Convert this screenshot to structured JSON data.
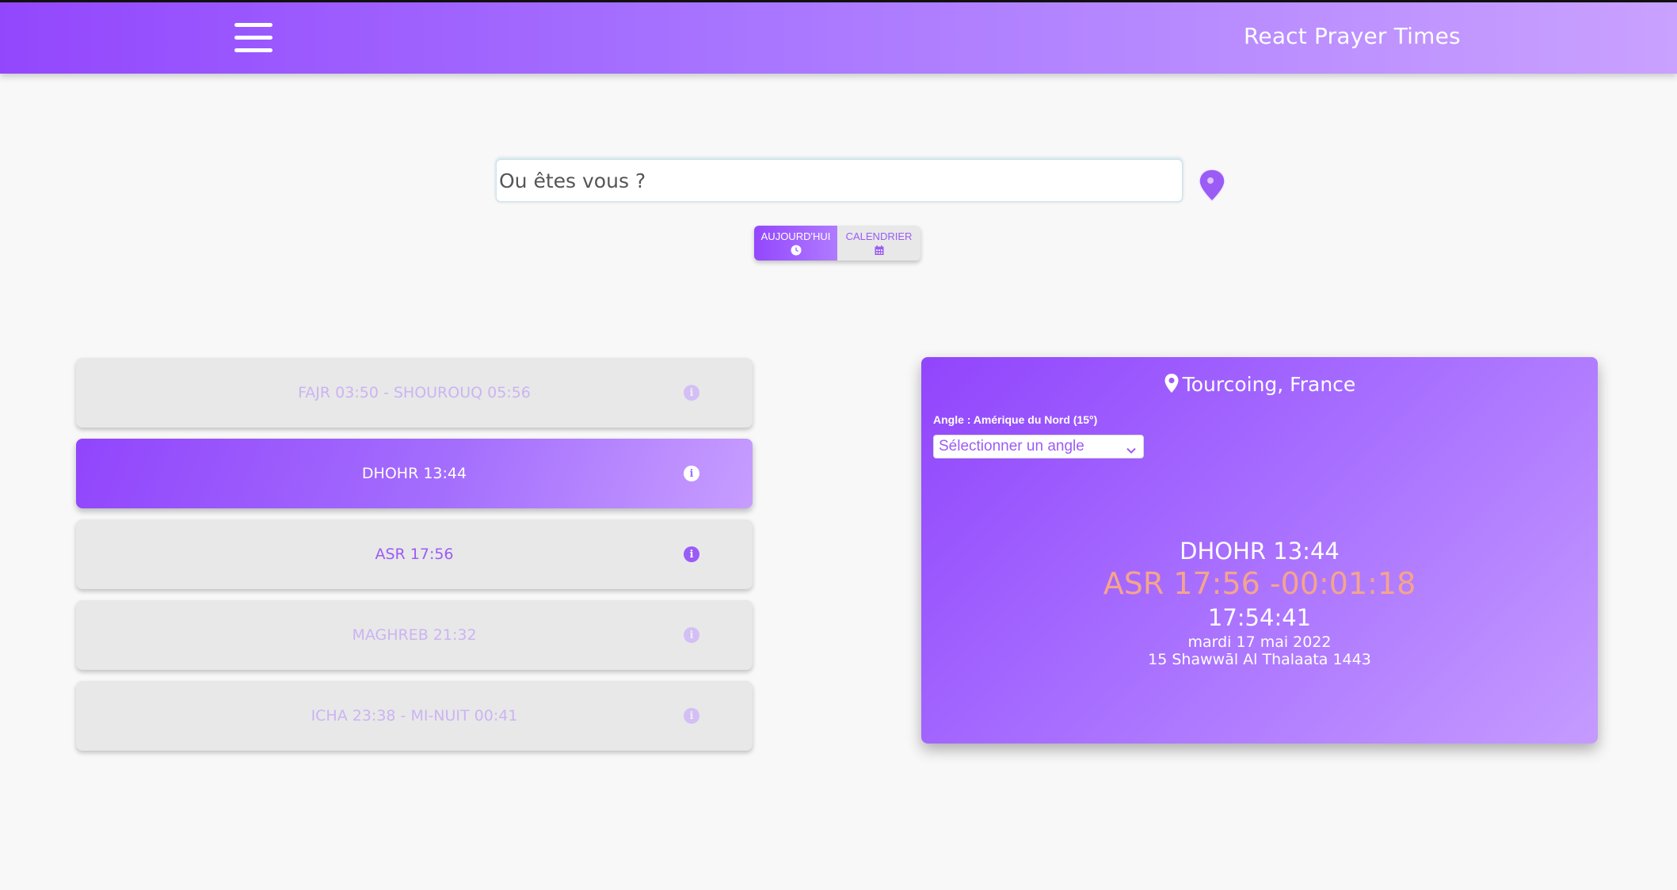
{
  "header": {
    "title": "React Prayer Times",
    "menu_icon": "hamburger-menu-icon"
  },
  "search": {
    "placeholder": "Ou êtes vous ?",
    "value": "",
    "locate_icon": "map-pin-icon"
  },
  "view_toggle": {
    "today_label": "AUJOURD'HUI",
    "today_icon": "clock-icon",
    "calendar_label": "CALENDRIER",
    "calendar_icon": "calendar-icon",
    "active": "today"
  },
  "prayers": [
    {
      "label": "FAJR 03:50 - SHOUROUQ 05:56",
      "state": "past"
    },
    {
      "label": "DHOHR 13:44",
      "state": "current"
    },
    {
      "label": "ASR 17:56",
      "state": "next"
    },
    {
      "label": "MAGHREB 21:32",
      "state": "upcoming"
    },
    {
      "label": "ICHA 23:38 - MI-NUIT 00:41",
      "state": "upcoming"
    }
  ],
  "panel": {
    "city": "Tourcoing, France",
    "angle_label": "Angle : Amérique du Nord (15°)",
    "angle_select": "Sélectionner un angle",
    "current_prayer": "DHOHR 13:44",
    "next_prayer": "ASR 17:56 -00:01:18",
    "clock": "17:54:41",
    "date": "mardi 17 mai 2022",
    "hijri_date": "15 Shawwāl Al Thalaata 1443"
  },
  "colors": {
    "accent": "#9347fd",
    "accent_light": "#c9a1ff",
    "countdown": "#f5a48c",
    "card_bg": "#e8e8e8"
  }
}
